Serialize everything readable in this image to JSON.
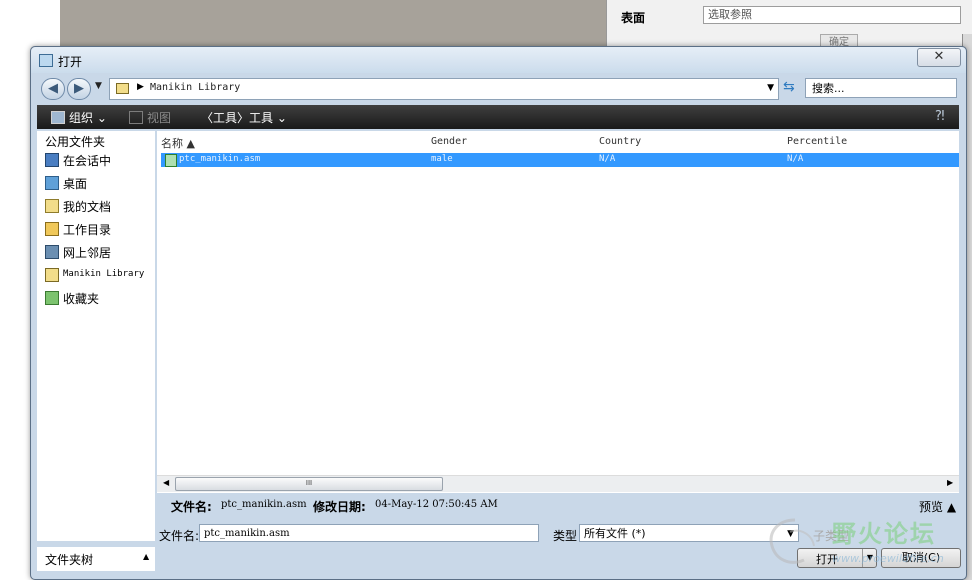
{
  "background": {
    "panel_label": "表面",
    "panel_field": "选取参照",
    "panel_ok": "确定"
  },
  "dialog": {
    "title": "打开",
    "address": {
      "path": "Manikin Library",
      "search_placeholder": "搜索..."
    },
    "toolbar": {
      "organize": "组织 ⌄",
      "view": "视图",
      "tools": "〈工具〉工具 ⌄"
    },
    "nav": {
      "header": "公用文件夹",
      "items": [
        {
          "label": "在会话中",
          "icon": "monitor-icon"
        },
        {
          "label": "桌面",
          "icon": "desktop-icon"
        },
        {
          "label": "我的文档",
          "icon": "documents-folder-icon"
        },
        {
          "label": "工作目录",
          "icon": "working-dir-icon"
        },
        {
          "label": "网上邻居",
          "icon": "network-icon"
        },
        {
          "label": "Manikin Library",
          "icon": "library-folder-icon"
        },
        {
          "label": "收藏夹",
          "icon": "favorites-icon"
        }
      ],
      "footer": "文件夹树"
    },
    "columns": {
      "name": "名称 ▲",
      "gender": "Gender",
      "country": "Country",
      "percentile": "Percentile"
    },
    "rows": [
      {
        "name": "ptc_manikin.asm",
        "gender": "male",
        "country": "N/A",
        "percentile": "N/A"
      }
    ],
    "details": {
      "filename_label": "文件名:",
      "filename": "ptc_manikin.asm",
      "modified_label": "修改日期:",
      "modified": "04-May-12 07:50:45 AM",
      "preview": "预览 ▲"
    },
    "filename_row": {
      "label": "文件名:",
      "value": "ptc_manikin.asm",
      "type_label": "类型",
      "type_value": "所有文件 (*)",
      "sub_type": "子类型"
    },
    "buttons": {
      "open": "打开",
      "cancel": "取消(C)"
    }
  },
  "watermark": {
    "text": "野火论坛",
    "url": "www.proewildfire.cn"
  },
  "colors": {
    "selection": "#3399ff",
    "toolbar": "#2a2a2a",
    "frame": "#c9d8e8"
  }
}
